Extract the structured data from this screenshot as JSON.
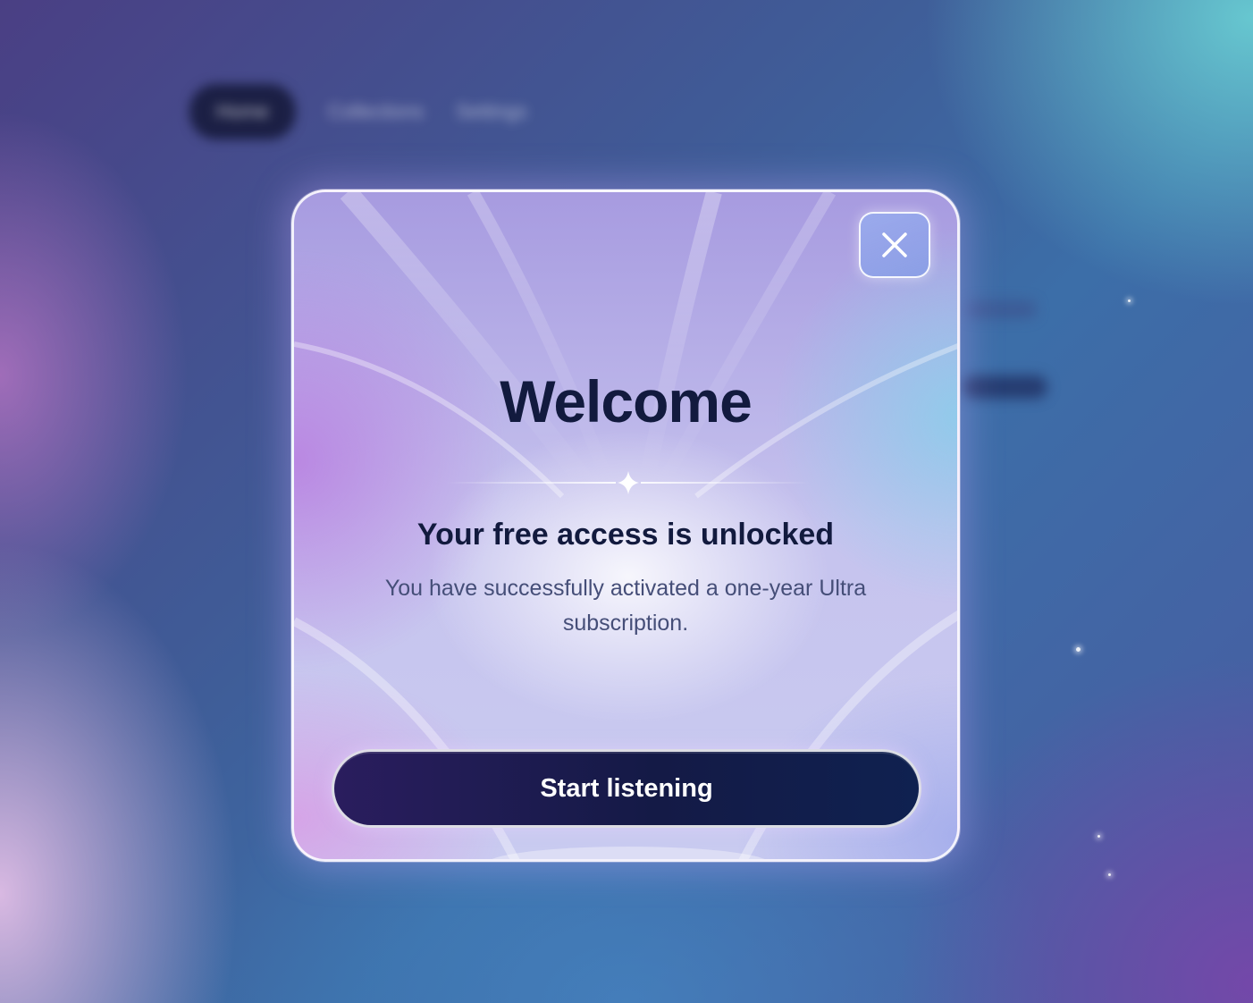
{
  "background_nav": {
    "items": [
      "Home",
      "Collections",
      "Settings"
    ]
  },
  "dialog": {
    "close_icon": "close-icon",
    "title": "Welcome",
    "divider_icon": "sparkle-icon",
    "subtitle": "Your free access is unlocked",
    "message": "You have successfully activated a one-year Ultra subscription.",
    "button_label": "Start listening"
  },
  "colors": {
    "title": "#121a3e",
    "body_text": "#454e78",
    "button_bg": "#141a46",
    "button_text": "#ffffff"
  }
}
